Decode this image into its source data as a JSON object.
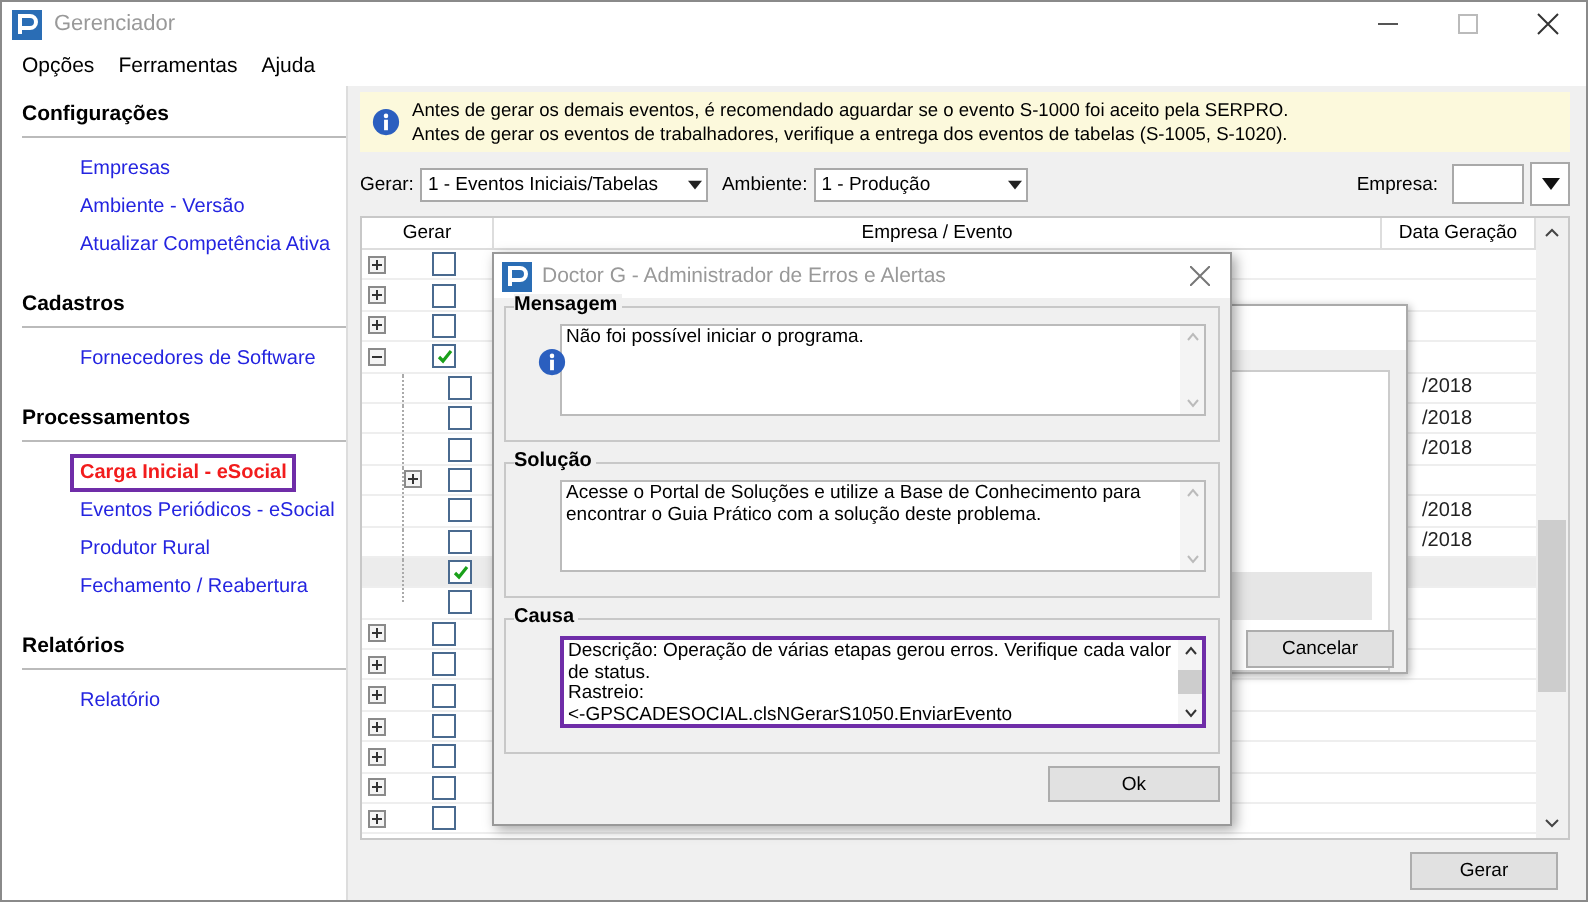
{
  "window": {
    "title": "Gerenciador"
  },
  "menu": [
    "Opções",
    "Ferramentas",
    "Ajuda"
  ],
  "sidebar": [
    {
      "heading": "Configurações",
      "items": [
        {
          "label": "Empresas",
          "selected": false
        },
        {
          "label": "Ambiente - Versão",
          "selected": false
        },
        {
          "label": "Atualizar Competência Ativa",
          "selected": false
        }
      ]
    },
    {
      "heading": "Cadastros",
      "items": [
        {
          "label": "Fornecedores de Software",
          "selected": false
        }
      ]
    },
    {
      "heading": "Processamentos",
      "items": [
        {
          "label": "Carga Inicial - eSocial",
          "selected": true
        },
        {
          "label": "Eventos Periódicos - eSocial",
          "selected": false
        },
        {
          "label": "Produtor Rural",
          "selected": false
        },
        {
          "label": "Fechamento / Reabertura",
          "selected": false
        }
      ]
    },
    {
      "heading": "Relatórios",
      "items": [
        {
          "label": "Relatório",
          "selected": false
        }
      ]
    }
  ],
  "notice": [
    "Antes de gerar os demais eventos, é recomendado aguardar se o evento S-1000 foi aceito pela SERPRO.",
    "Antes de gerar os eventos de trabalhadores, verifique a entrega dos eventos de tabelas (S-1005, S-1020)."
  ],
  "filters": {
    "gerar_label": "Gerar:",
    "gerar_value": "1 - Eventos Iniciais/Tabelas",
    "ambiente_label": "Ambiente:",
    "ambiente_value": "1 - Produção",
    "empresa_label": "Empresa:"
  },
  "table": {
    "columns": [
      "Gerar",
      "Empresa / Evento",
      "Data Geração"
    ],
    "rows": [
      {
        "kind": "group",
        "expanded": false,
        "checked": false,
        "selected": false
      },
      {
        "kind": "group",
        "expanded": false,
        "checked": false,
        "selected": false
      },
      {
        "kind": "group",
        "expanded": false,
        "checked": false,
        "selected": false
      },
      {
        "kind": "group",
        "expanded": true,
        "checked": true,
        "selected": false,
        "children": [
          {
            "kind": "item",
            "checked": false,
            "selected": false,
            "date": "/2018"
          },
          {
            "kind": "item",
            "checked": false,
            "selected": false,
            "date": "/2018"
          },
          {
            "kind": "item",
            "checked": false,
            "selected": false,
            "date": "/2018"
          },
          {
            "kind": "group",
            "expanded": false,
            "checked": false,
            "selected": false
          },
          {
            "kind": "item",
            "checked": false,
            "selected": false,
            "date": "/2018"
          },
          {
            "kind": "item",
            "checked": false,
            "selected": false,
            "date": "/2018"
          },
          {
            "kind": "item",
            "checked": true,
            "selected": true
          },
          {
            "kind": "item",
            "checked": false,
            "selected": false
          }
        ]
      },
      {
        "kind": "group",
        "expanded": false,
        "checked": false,
        "selected": false
      },
      {
        "kind": "group",
        "expanded": false,
        "checked": false,
        "selected": false
      },
      {
        "kind": "group",
        "expanded": false,
        "checked": false,
        "selected": false
      },
      {
        "kind": "group",
        "expanded": false,
        "checked": false,
        "selected": false
      },
      {
        "kind": "group",
        "expanded": false,
        "checked": false,
        "selected": false
      },
      {
        "kind": "group",
        "expanded": false,
        "checked": false,
        "selected": false
      },
      {
        "kind": "group",
        "expanded": false,
        "checked": false,
        "selected": false
      }
    ]
  },
  "generate_button": "Gerar",
  "background_dialog": {
    "cancel_button": "Cancelar"
  },
  "dialog": {
    "title": "Doctor G - Administrador de Erros e Alertas",
    "sections": [
      {
        "title": "Mensagem",
        "icon": true,
        "highlighted": false,
        "lines": [
          "Não foi possível iniciar o programa."
        ]
      },
      {
        "title": "Solução",
        "icon": false,
        "highlighted": false,
        "lines": [
          "Acesse o Portal de Soluções e utilize a Base de Conhecimento para encontrar o Guia Prático com a solução deste problema."
        ]
      },
      {
        "title": "Causa",
        "icon": false,
        "highlighted": true,
        "lines": [
          "Descrição: Operação de várias etapas gerou erros. Verifique cada valor de status.",
          "Rastreio:",
          "<-GPSCADESOCIAL.clsNGerarS1050.EnviarEvento"
        ]
      }
    ],
    "ok_button": "Ok"
  }
}
